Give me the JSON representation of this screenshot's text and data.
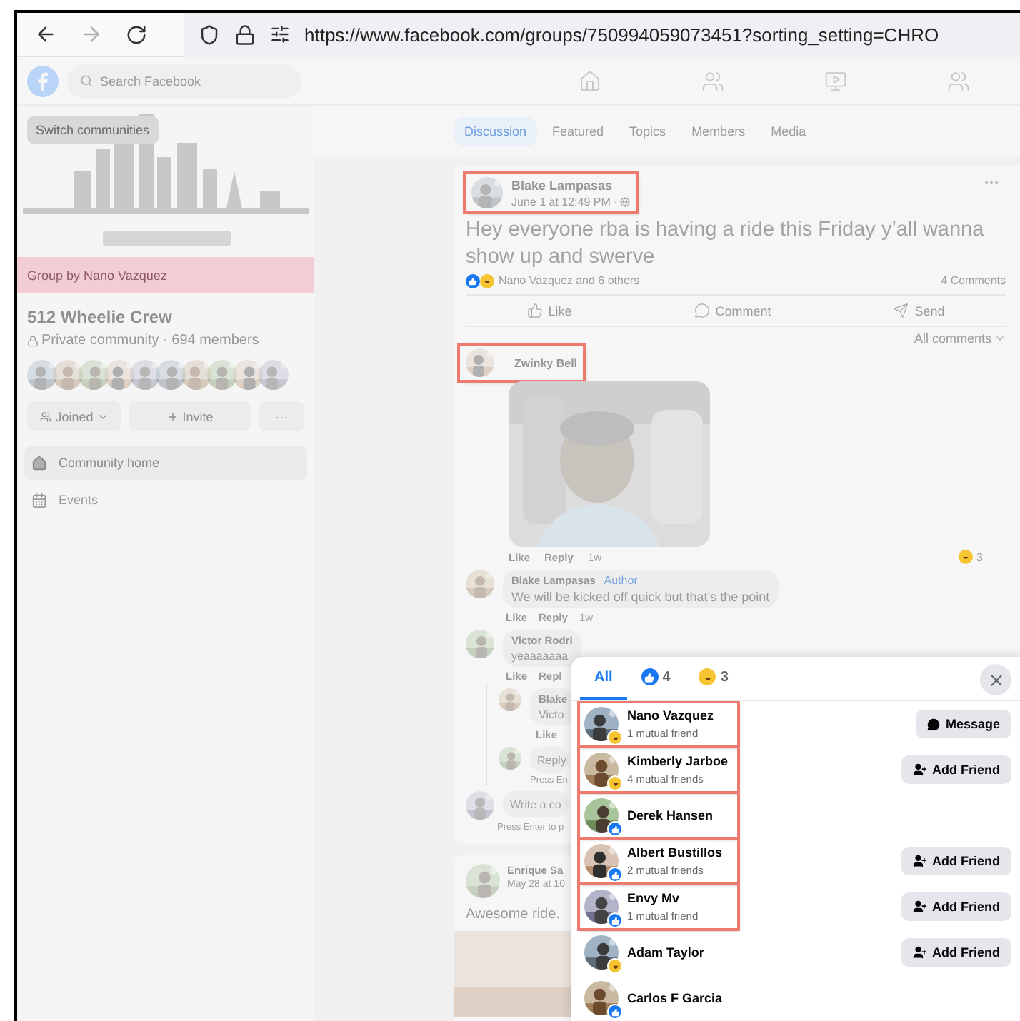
{
  "browser": {
    "url": "https://www.facebook.com/groups/750994059073451?sorting_setting=CHRO"
  },
  "header": {
    "search": {
      "placeholder": "Search Facebook"
    },
    "nav": [
      {
        "kind": "home"
      },
      {
        "kind": "friends"
      },
      {
        "kind": "watch"
      },
      {
        "kind": "groups"
      }
    ]
  },
  "sidebar": {
    "switch_button": "Switch communities",
    "banner": "Group by Nano Vazquez",
    "group_name": "512 Wheelie Crew",
    "privacy": "Private community · 694 members",
    "actions": [
      {
        "kind": "joined",
        "label": "Joined"
      },
      {
        "kind": "invite",
        "label": "Invite"
      },
      {
        "kind": "more",
        "label": "···"
      }
    ],
    "nav": [
      {
        "kind": "home",
        "label": "Community home",
        "selected": true
      },
      {
        "kind": "calendar",
        "label": "Events",
        "selected": false
      }
    ]
  },
  "tabs": [
    {
      "label": "Discussion",
      "selected": true
    },
    {
      "label": "Featured",
      "selected": false
    },
    {
      "label": "Topics",
      "selected": false
    },
    {
      "label": "Members",
      "selected": false
    },
    {
      "label": "Media",
      "selected": false
    }
  ],
  "post": {
    "author": "Blake Lampasas",
    "highlighted": true,
    "time": "June 1 at 12:49 PM ·",
    "text": "Hey everyone rba is having a ride this Friday y’all wanna show up and swerve",
    "reactions": "Nano Vazquez and 6 others",
    "comments_count": "4 Comments",
    "actions": [
      {
        "kind": "like",
        "label": "Like"
      },
      {
        "kind": "comment",
        "label": "Comment"
      },
      {
        "kind": "send",
        "label": "Send"
      }
    ],
    "sort": "All comments",
    "comments": [
      {
        "kind": "gif",
        "author": "Zwinky Bell",
        "highlighted": true,
        "links": [
          "Like",
          "Reply"
        ],
        "age": "1w",
        "reaction_count": "3"
      },
      {
        "kind": "text",
        "author": "Blake Lampasas",
        "badge": "Author",
        "text": "We will be kicked off quick but that’s the point",
        "links": [
          "Like",
          "Reply"
        ],
        "age": "1w"
      },
      {
        "kind": "text",
        "author": "Victor Rodri",
        "text": "yeaaaaaaa",
        "links": [
          "Like",
          "Repl"
        ]
      }
    ],
    "thread": {
      "reply": {
        "author": "Blake",
        "text": "Victo",
        "links": [
          "Like"
        ]
      },
      "field": {
        "placeholder": "Reply"
      },
      "hint": "Press En"
    },
    "write": {
      "placeholder": "Write a co",
      "hint": "Press Enter to p"
    }
  },
  "next_post": {
    "author": "Enrique Sa",
    "time": "May 28 at 10",
    "text": "Awesome ride."
  },
  "reactions_dialog": {
    "tabs": [
      {
        "kind": "all",
        "label": "All",
        "selected": true
      },
      {
        "kind": "like",
        "label": "4",
        "selected": false
      },
      {
        "kind": "haha",
        "label": "3",
        "selected": false
      }
    ],
    "people": [
      {
        "name": "Nano Vazquez",
        "mutual": "1 mutual friend",
        "kind": "haha",
        "highlighted": true,
        "action": {
          "kind": "message",
          "label": "Message"
        }
      },
      {
        "name": "Kimberly Jarboe",
        "mutual": "4 mutual friends",
        "kind": "haha",
        "highlighted": true,
        "action": {
          "kind": "add",
          "label": "Add Friend"
        }
      },
      {
        "name": "Derek Hansen",
        "kind": "like",
        "highlighted": true
      },
      {
        "name": "Albert Bustillos",
        "mutual": "2 mutual friends",
        "kind": "like",
        "highlighted": true,
        "action": {
          "kind": "add",
          "label": "Add Friend"
        }
      },
      {
        "name": "Envy Mv",
        "mutual": "1 mutual friend",
        "kind": "like",
        "highlighted": true,
        "action": {
          "kind": "add",
          "label": "Add Friend"
        }
      },
      {
        "name": "Adam Taylor",
        "kind": "haha",
        "highlighted": false,
        "action": {
          "kind": "add",
          "label": "Add Friend"
        }
      },
      {
        "name": "Carlos F Garcia",
        "kind": "like",
        "highlighted": false
      }
    ]
  }
}
